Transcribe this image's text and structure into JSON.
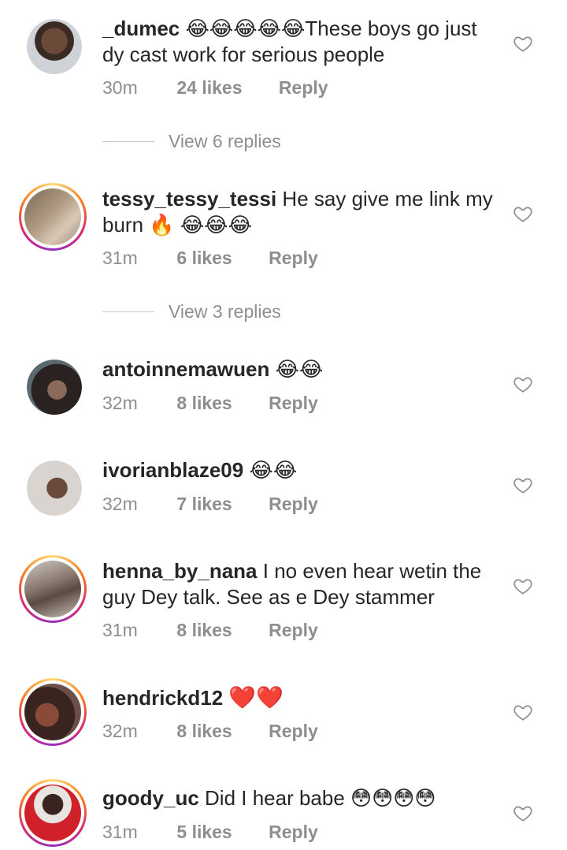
{
  "comments": [
    {
      "username": "_dumec",
      "text": "😂😂😂😂😂These boys go just dy cast work for serious people",
      "time": "30m",
      "likes": "24 likes",
      "reply": "Reply",
      "view_replies": "View 6 replies"
    },
    {
      "username": "tessy_tessy_tessi",
      "text": "He say give me link my burn 🔥 😂😂😂",
      "time": "31m",
      "likes": "6 likes",
      "reply": "Reply",
      "view_replies": "View 3 replies"
    },
    {
      "username": "antoinnemawuen",
      "text": "😂😂",
      "time": "32m",
      "likes": "8 likes",
      "reply": "Reply"
    },
    {
      "username": "ivorianblaze09",
      "text": "😂😂",
      "time": "32m",
      "likes": "7 likes",
      "reply": "Reply"
    },
    {
      "username": "henna_by_nana",
      "text": "I no even hear wetin the guy Dey talk. See as e Dey stammer",
      "time": "31m",
      "likes": "8 likes",
      "reply": "Reply"
    },
    {
      "username": "hendrickd12",
      "text": "❤️❤️",
      "time": "32m",
      "likes": "8 likes",
      "reply": "Reply"
    },
    {
      "username": "goody_uc",
      "text": "Did I hear babe 😳😳😳😳",
      "time": "31m",
      "likes": "5 likes",
      "reply": "Reply"
    }
  ],
  "icons": {
    "like": "heart-outline-icon"
  },
  "colors": {
    "text": "#262626",
    "muted": "#8e8e8e"
  }
}
